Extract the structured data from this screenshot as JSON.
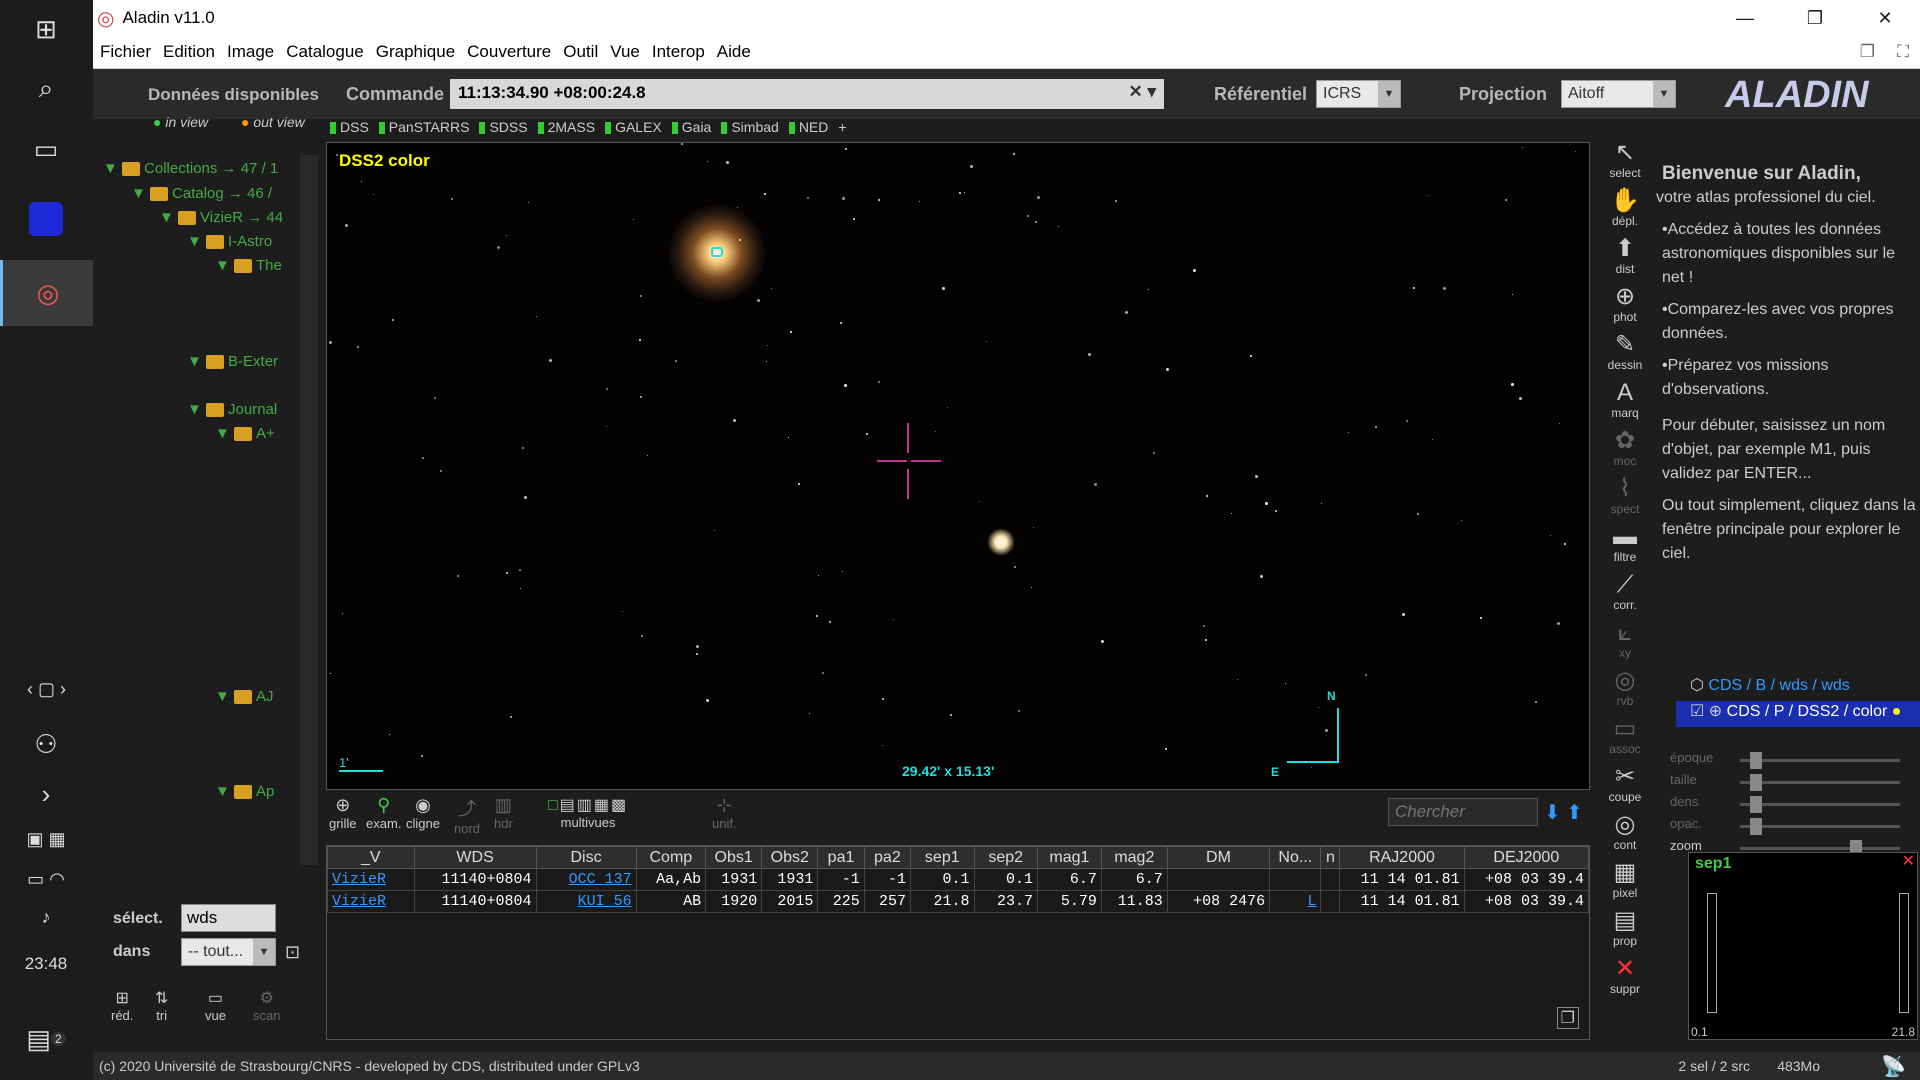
{
  "window": {
    "title": "Aladin v11.0"
  },
  "taskbar": {
    "time": "23:48",
    "notif_count": "2"
  },
  "menu": [
    "Fichier",
    "Edition",
    "Image",
    "Catalogue",
    "Graphique",
    "Couverture",
    "Outil",
    "Vue",
    "Interop",
    "Aide"
  ],
  "command": {
    "available_label": "Données disponibles",
    "in_view": "in view",
    "out_view": "out view",
    "command_label": "Commande",
    "command_value": "11:13:34.90 +08:00:24.8",
    "ref_label": "Référentiel",
    "ref_value": "ICRS",
    "proj_label": "Projection",
    "proj_value": "Aitoff"
  },
  "surveys": [
    "DSS",
    "PanSTARRS",
    "SDSS",
    "2MASS",
    "GALEX",
    "Gaia",
    "Simbad",
    "NED",
    "+"
  ],
  "tree": [
    {
      "label": "Collections → 47 / 1",
      "indent": 0
    },
    {
      "label": "Catalog → 46 /",
      "indent": 1
    },
    {
      "label": "VizieR → 44",
      "indent": 2
    },
    {
      "label": "I-Astro",
      "indent": 3
    },
    {
      "label": "The",
      "indent": 4
    },
    {
      "label": "B-Exter",
      "indent": 3
    },
    {
      "label": "Journal",
      "indent": 3
    },
    {
      "label": "A+",
      "indent": 4
    },
    {
      "label": "AJ",
      "indent": 4
    },
    {
      "label": "Ap",
      "indent": 4
    }
  ],
  "viewer": {
    "label": "DSS2 color",
    "scale": "1'",
    "fov": "29.42' x 15.13'",
    "north": "N",
    "east": "E"
  },
  "tools_bottom": {
    "grille": "grille",
    "exam": "exam.",
    "cligne": "cligne",
    "nord": "nord",
    "hdr": "hdr",
    "multivues": "multivues",
    "unif": "unif.",
    "search_placeholder": "Chercher"
  },
  "table": {
    "headers": [
      "_V",
      "WDS",
      "Disc",
      "Comp",
      "Obs1",
      "Obs2",
      "pa1",
      "pa2",
      "sep1",
      "sep2",
      "mag1",
      "mag2",
      "DM",
      "No...",
      "n",
      "RAJ2000",
      "DEJ2000"
    ],
    "rows": [
      [
        "VizieR",
        "11140+0804",
        "OCC 137",
        "Aa,Ab",
        "1931",
        "1931",
        "-1",
        "-1",
        "0.1",
        "0.1",
        "6.7",
        "6.7",
        "",
        "",
        "",
        "11 14 01.81",
        "+08 03 39.4"
      ],
      [
        "VizieR",
        "11140+0804",
        "KUI 56",
        "AB",
        "1920",
        "2015",
        "225",
        "257",
        "21.8",
        "23.7",
        "5.79",
        "11.83",
        "+08 2476",
        "L",
        "",
        "11 14 01.81",
        "+08 03 39.4"
      ]
    ]
  },
  "select": {
    "label": "sélect.",
    "value": "wds",
    "dans_label": "dans",
    "dans_value": "-- tout..."
  },
  "bottom_tools": [
    "réd.",
    "tri",
    "vue",
    "scan"
  ],
  "right_tools": [
    "select",
    "dépl.",
    "dist",
    "phot",
    "dessin",
    "marq",
    "moc",
    "spect",
    "filtre",
    "corr.",
    "xy",
    "rvb",
    "assoc",
    "coupe",
    "cont",
    "pixel",
    "prop",
    "suppr"
  ],
  "welcome": {
    "title": "Bienvenue sur Aladin,",
    "lines": [
      "votre atlas professionel du ciel.",
      "•Accédez à toutes les données astronomiques disponibles sur le net !",
      "•Comparez-les avec vos propres données.",
      "•Préparez vos missions d'observations.",
      "Pour débuter, saisissez un nom d'objet, par exemple M1, puis validez par ENTER...",
      "Ou tout simplement, cliquez dans la fenêtre principale pour explorer le ciel."
    ]
  },
  "layers": [
    {
      "label": "CDS / B / wds / wds"
    },
    {
      "label": "CDS / P / DSS2 / color"
    }
  ],
  "sliders": [
    "époque",
    "taille",
    "dens",
    "opac.",
    "zoom"
  ],
  "histogram": {
    "label": "sep1",
    "min": "0.1",
    "max": "21.8"
  },
  "status": {
    "copyright": "(c) 2020 Université de Strasbourg/CNRS - developed by CDS, distributed under GPLv3",
    "sel": "2 sel / 2 src",
    "mem": "483Mo"
  }
}
